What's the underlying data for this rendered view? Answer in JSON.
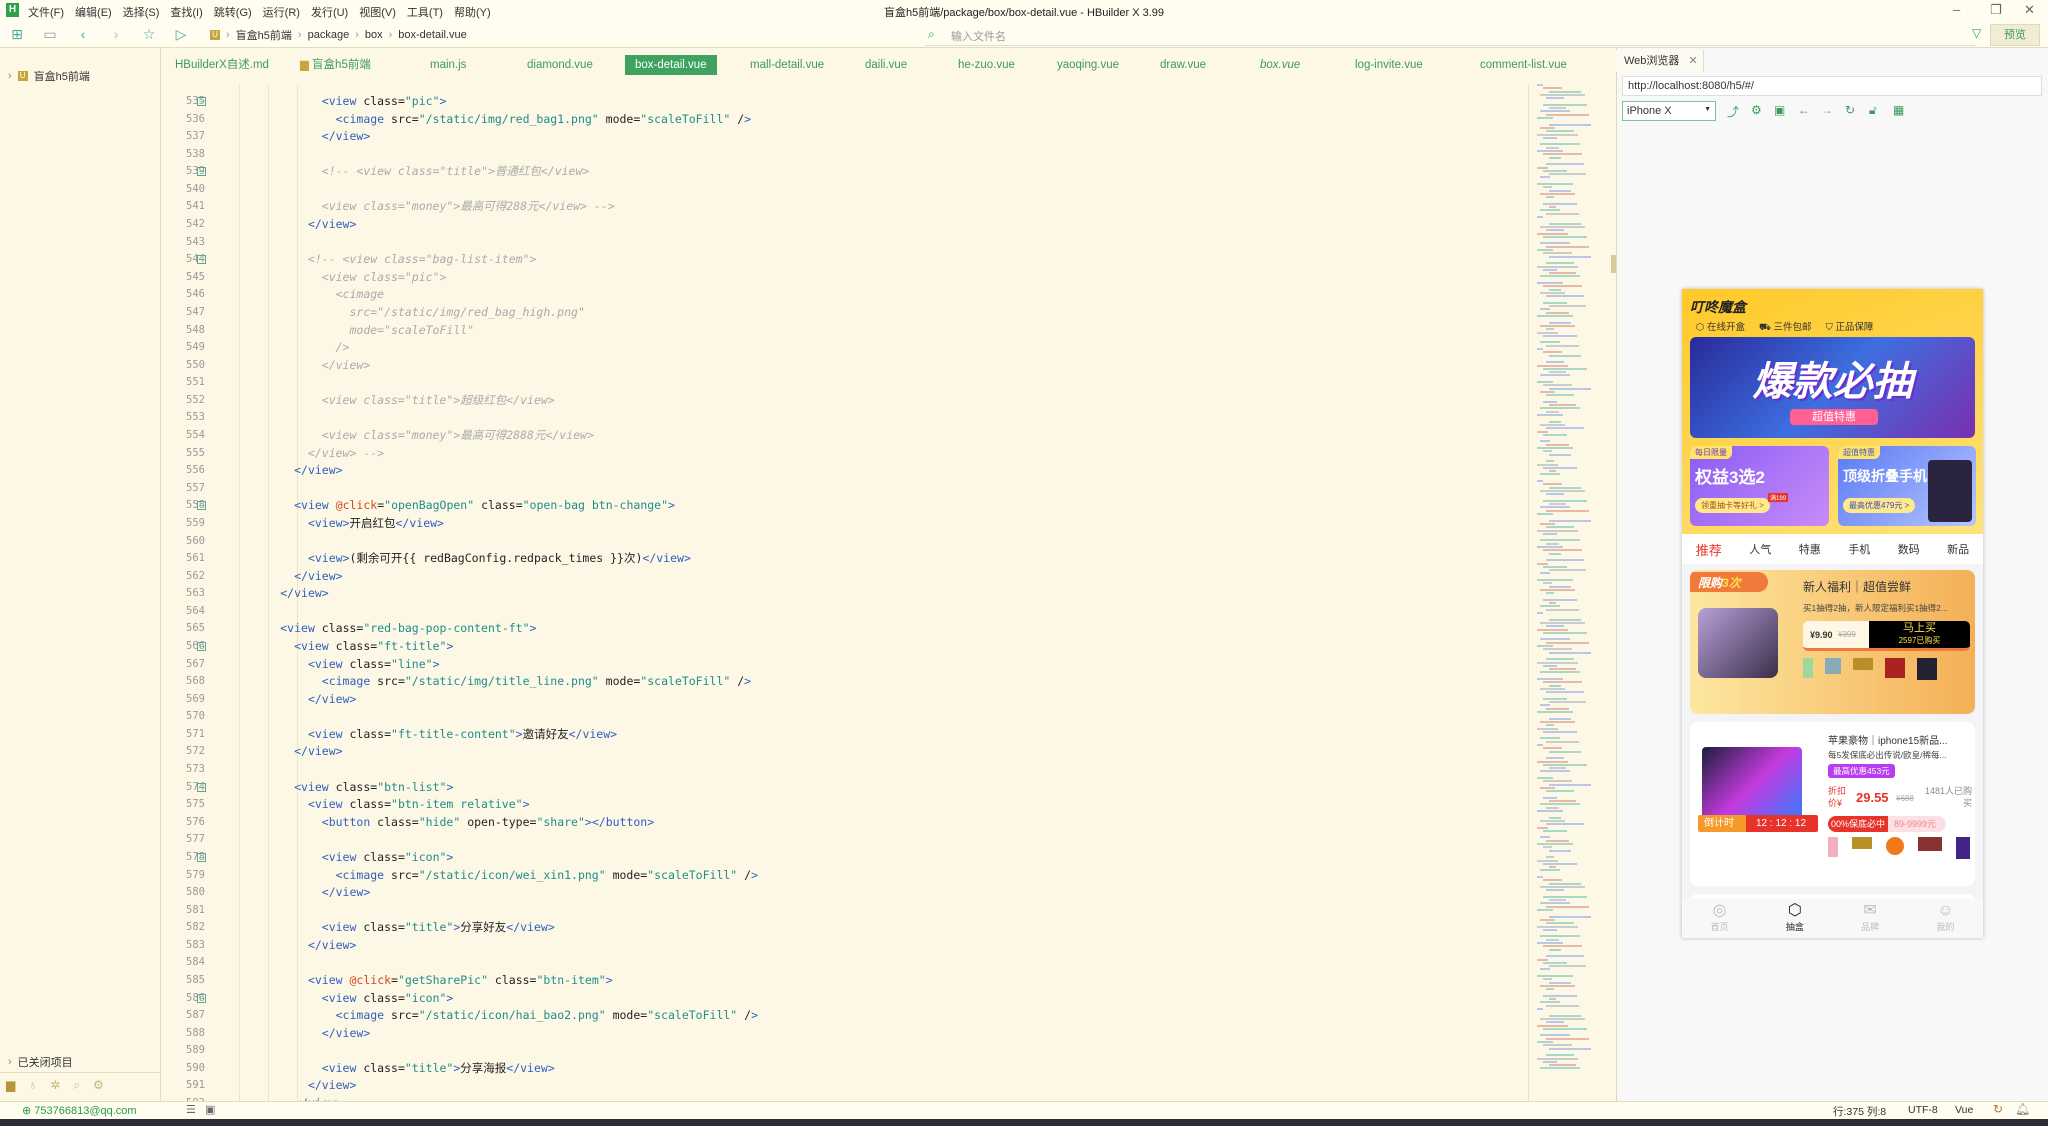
{
  "app": {
    "title": "盲盒h5前端/package/box/box-detail.vue - HBuilder X 3.99",
    "logo": "H"
  },
  "menu": [
    "文件(F)",
    "编辑(E)",
    "选择(S)",
    "查找(I)",
    "跳转(G)",
    "运行(R)",
    "发行(U)",
    "视图(V)",
    "工具(T)",
    "帮助(Y)"
  ],
  "breadcrumb": [
    "盲盒h5前端",
    "package",
    "box",
    "box-detail.vue"
  ],
  "search": {
    "placeholder": "输入文件名"
  },
  "preview_label": "预览",
  "sidebar": {
    "project": "盲盒h5前端",
    "closed": "已关闭项目"
  },
  "tabs": [
    {
      "label": "HBuilderX自述.md"
    },
    {
      "label": "盲盒h5前端"
    },
    {
      "label": "main.js"
    },
    {
      "label": "diamond.vue"
    },
    {
      "label": "box-detail.vue",
      "active": true
    },
    {
      "label": "mall-detail.vue"
    },
    {
      "label": "daili.vue"
    },
    {
      "label": "he-zuo.vue"
    },
    {
      "label": "yaoqing.vue"
    },
    {
      "label": "draw.vue"
    },
    {
      "label": "box.vue"
    },
    {
      "label": "log-invite.vue"
    },
    {
      "label": "comment-list.vue"
    }
  ],
  "code": {
    "start": 535,
    "folds": [
      535,
      539,
      544,
      558,
      566,
      574,
      578,
      586
    ],
    "lines": [
      "                <view class=\"pic\">",
      "                  <cimage src=\"/static/img/red_bag1.png\" mode=\"scaleToFill\" />",
      "                </view>",
      "",
      "                <!-- <view class=\"title\">普通红包</view>",
      "",
      "                <view class=\"money\">最高可得288元</view> -->",
      "              </view>",
      "",
      "              <!-- <view class=\"bag-list-item\">",
      "                <view class=\"pic\">",
      "                  <cimage",
      "                    src=\"/static/img/red_bag_high.png\"",
      "                    mode=\"scaleToFill\"",
      "                  />",
      "                </view>",
      "",
      "                <view class=\"title\">超级红包</view>",
      "",
      "                <view class=\"money\">最高可得2888元</view>",
      "              </view> -->",
      "            </view>",
      "",
      "            <view @click=\"openBagOpen\" class=\"open-bag btn-change\">",
      "              <view>开启红包</view>",
      "",
      "              <view>(剩余可开{{ redBagConfig.redpack_times }}次)</view>",
      "            </view>",
      "          </view>",
      "",
      "          <view class=\"red-bag-pop-content-ft\">",
      "            <view class=\"ft-title\">",
      "              <view class=\"line\">",
      "                <cimage src=\"/static/img/title_line.png\" mode=\"scaleToFill\" />",
      "              </view>",
      "",
      "              <view class=\"ft-title-content\">邀请好友</view>",
      "            </view>",
      "",
      "            <view class=\"btn-list\">",
      "              <view class=\"btn-item relative\">",
      "                <button class=\"hide\" open-type=\"share\"></button>",
      "",
      "                <view class=\"icon\">",
      "                  <cimage src=\"/static/icon/wei_xin1.png\" mode=\"scaleToFill\" />",
      "                </view>",
      "",
      "                <view class=\"title\">分享好友</view>",
      "              </view>",
      "",
      "              <view @click=\"getSharePic\" class=\"btn-item\">",
      "                <view class=\"icon\">",
      "                  <cimage src=\"/static/icon/hai_bao2.png\" mode=\"scaleToFill\" />",
      "                </view>",
      "",
      "                <view class=\"title\">分享海报</view>",
      "              </view>",
      "            </view>"
    ]
  },
  "browser": {
    "tab": "Web浏览器",
    "url": "http://localhost:8080/h5/#/",
    "device": "iPhone X"
  },
  "phone": {
    "brand": "叮咚魔盒",
    "features": [
      "在线开盒",
      "三件包邮",
      "正品保障"
    ],
    "banner": {
      "title": "爆款必抽",
      "badge": "超值特惠"
    },
    "promos": [
      {
        "tag": "每日限量",
        "title": "权益3选2",
        "btn": "领重抽卡等好礼 >",
        "mini": "满199"
      },
      {
        "tag": "超值特惠",
        "title": "顶级折叠手机",
        "btn": "最高优惠479元 >"
      }
    ],
    "cats": [
      "推荐",
      "人气",
      "特惠",
      "手机",
      "数码",
      "新品"
    ],
    "card1": {
      "tag_a": "限购",
      "tag_b": "3次",
      "title": "新人福利｜超值尝鲜",
      "desc": "买1抽得2抽，新人限定福利买1抽得2...",
      "price": "¥9.90",
      "old": "¥399",
      "buy": "马上买",
      "sold": "2597已购买"
    },
    "card2": {
      "title": "苹果豪物｜iphone15新品...",
      "desc": "每5发保底必出传说/欧皇/稀每...",
      "badge": "最高优惠453元",
      "price_label": "折扣价¥",
      "price": "29.55",
      "old": "¥688",
      "sold": "1481人已购买",
      "guarantee": "00%保底必中",
      "range": "89-9999元",
      "countdown_label": "倒计时",
      "countdown": "12 : 12 : 12"
    },
    "nav": [
      {
        "label": "首页"
      },
      {
        "label": "抽盒",
        "active": true
      },
      {
        "label": "品牌"
      },
      {
        "label": "我的"
      }
    ],
    "colors": {
      "yellow": "#ffd84a",
      "red": "#e8332a",
      "purple": "#b83cf0"
    }
  },
  "status": {
    "account": "753766813@qq.com",
    "position": "行:375  列:8",
    "encoding": "UTF-8",
    "lang": "Vue"
  }
}
